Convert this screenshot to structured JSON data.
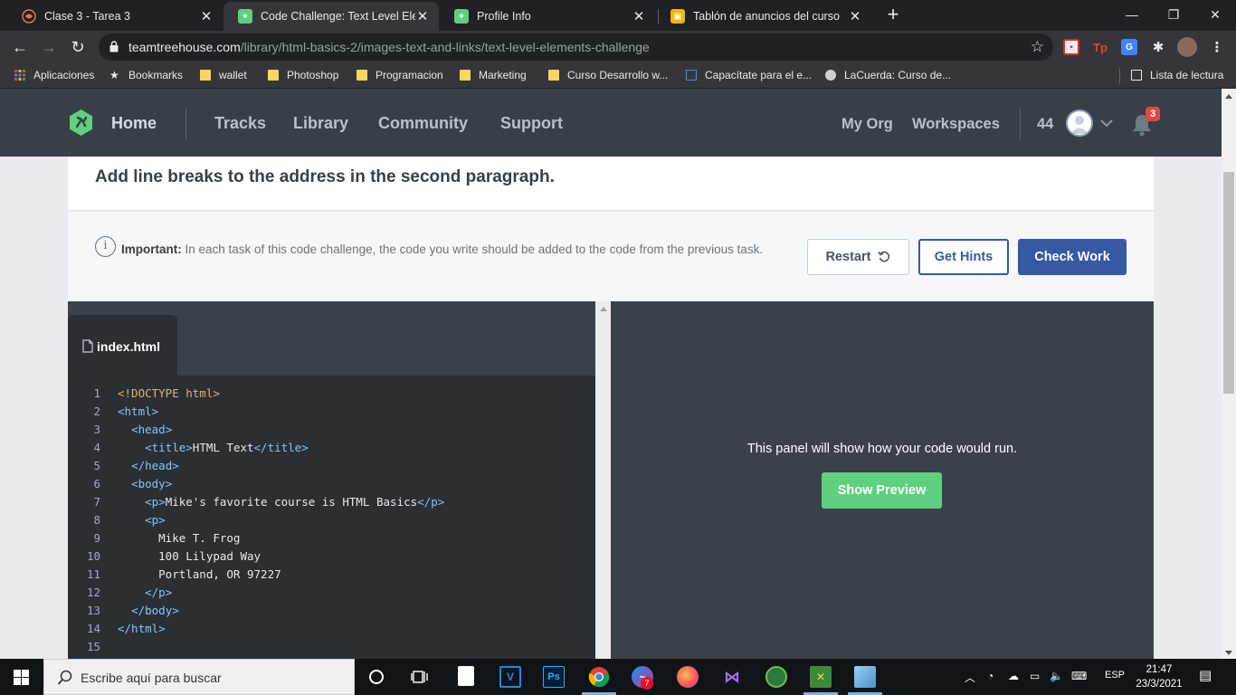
{
  "browser": {
    "tabs": [
      {
        "title": "Clase 3 - Tarea 3",
        "active": false
      },
      {
        "title": "Code Challenge: Text Level Eleme",
        "active": true
      },
      {
        "title": "Profile Info",
        "active": false
      },
      {
        "title": "Tablón de anuncios del curso",
        "active": false
      }
    ],
    "url_domain": "teamtreehouse.com",
    "url_path": "/library/html-basics-2/images-text-and-links/text-level-elements-challenge",
    "bookmarks": [
      "Aplicaciones",
      "Bookmarks",
      "wallet",
      "Photoshop",
      "Programacion",
      "Marketing",
      "Curso Desarrollo w...",
      "Capacítate para el e...",
      "LaCuerda: Curso de..."
    ],
    "reading_list": "Lista de lectura",
    "extension_badge": "Tp"
  },
  "site_header": {
    "home": "Home",
    "nav": [
      "Tracks",
      "Library",
      "Community",
      "Support"
    ],
    "right_nav": [
      "My Org",
      "Workspaces"
    ],
    "points": "44",
    "notification_count": "3"
  },
  "challenge": {
    "task": "Add line breaks to the address in the second paragraph.",
    "important_label": "Important:",
    "important_text": " In each task of this code challenge, the code you write should be added to the code from the previous task.",
    "buttons": {
      "restart": "Restart",
      "hints": "Get Hints",
      "check": "Check Work"
    }
  },
  "editor": {
    "file_name": "index.html",
    "line_numbers": [
      "1",
      "2",
      "3",
      "4",
      "5",
      "6",
      "7",
      "8",
      "9",
      "10",
      "11",
      "12",
      "13",
      "14",
      "15"
    ],
    "lines": [
      "<!DOCTYPE html>",
      "<html>",
      "  <head>",
      "    <title>HTML Text</title>",
      "  </head>",
      "  <body>",
      "    <p>Mike's favorite course is HTML Basics</p>",
      "    <p>",
      "      Mike T. Frog",
      "      100 Lilypad Way",
      "      Portland, OR 97227",
      "    </p>",
      "  </body>",
      "</html>",
      ""
    ]
  },
  "preview": {
    "message": "This panel will show how your code would run.",
    "button": "Show Preview"
  },
  "taskbar": {
    "search_placeholder": "Escribe aquí para buscar",
    "messenger_badge": "7",
    "language": "ESP",
    "time": "21:47",
    "date": "23/3/2021"
  },
  "colors": {
    "header_bg": "#384047",
    "accent_blue": "#3659a2",
    "preview_green": "#5fcf80",
    "editor_bg": "#2a2f34"
  }
}
